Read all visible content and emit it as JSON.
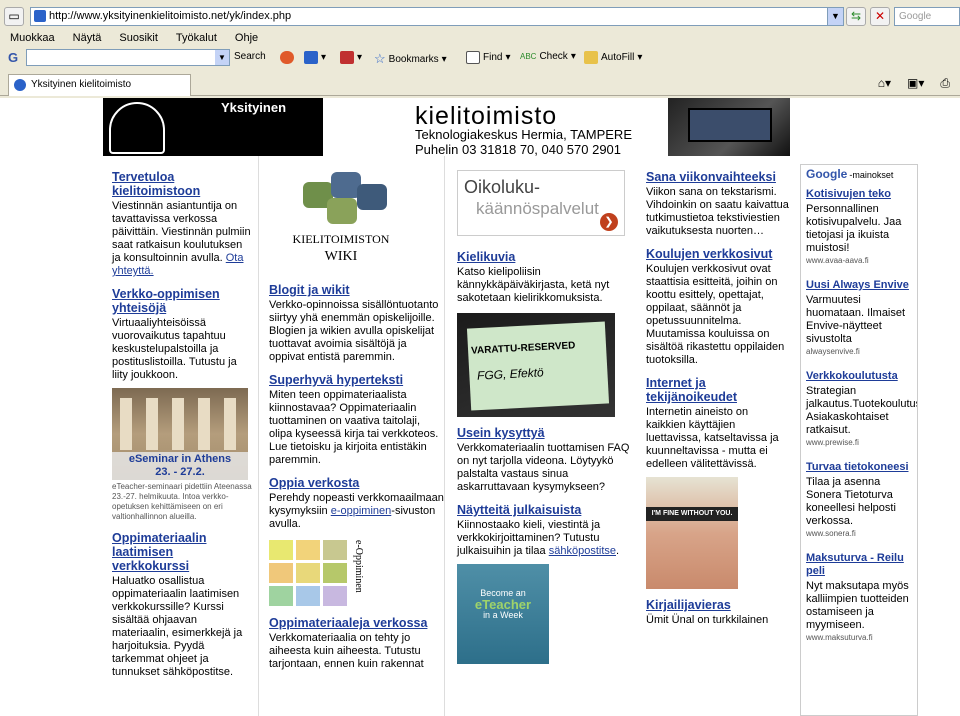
{
  "browser": {
    "url": "http://www.yksityinenkielitoimisto.net/yk/index.php",
    "search_placeholder": "Google",
    "menu": [
      "Muokkaa",
      "Näytä",
      "Suosikit",
      "Työkalut",
      "Ohje"
    ],
    "toolbar": {
      "search_label": "Search",
      "bookmarks_label": "Bookmarks",
      "find_label": "Find",
      "check_label": "Check",
      "autofill_label": "AutoFill"
    },
    "tab_title": "Yksityinen kielitoimisto"
  },
  "banner": {
    "small": "Yksityinen",
    "title": "kielitoimisto",
    "line1": "Teknologiakeskus Hermia, TAMPERE",
    "line2": "Puhelin 03 31818 70, 040 570 2901"
  },
  "col1": {
    "welcome_title": "Tervetuloa kielitoimistoon",
    "welcome_text": "Viestinnän asiantuntija on tavattavissa verkossa päivittäin. Viestinnän pulmiin saat ratkaisun koulutuksen ja konsultoinnin avulla.",
    "welcome_link": "Ota yhteyttä.",
    "community_title": "Verkko-oppimisen yhteisöjä",
    "community_text": "Virtuaaliyhteisöissä vuorovaikutus tapahtuu keskustelupalstoilla ja postituslistoilla. Tutustu ja liity joukkoon.",
    "athens_caption1": "eSeminar in Athens",
    "athens_caption2": "23. - 27.2.",
    "athens_small": "eTeacher-seminaari pidettiin Ateenassa 23.-27. helmikuuta. Intoa verkko-opetuksen kehittämiseen on eri valtionhallinnon alueilla.",
    "course_title": "Oppimateriaalin laatimisen verkkokurssi",
    "course_text": "Haluatko osallistua oppimateriaalin laatimisen verkkokurssille? Kurssi sisältää ohjaavan materiaalin, esimerkkejä ja harjoituksia. Pyydä tarkemmat ohjeet ja tunnukset sähköpostitse."
  },
  "col2": {
    "wiki_line1": "Kielitoimiston",
    "wiki_line2": "WIKI",
    "blogs_title": "Blogit ja wikit",
    "blogs_text": "Verkko-opinnoissa sisällöntuotanto siirtyy yhä enemmän opiskelijoille. Blogien ja wikien avulla opiskelijat tuottavat avoimia sisältöjä ja oppivat entistä paremmin.",
    "hyper_title": "Superhyvä hyperteksti",
    "hyper_text": "Miten teen oppimateriaalista kiinnostavaa? Oppimateriaalin tuottaminen on vaativa taitolaji, olipa kyseessä kirja tai verkkoteos. Lue tietoisku ja kirjoita entistäkin paremmin.",
    "learn_title": "Oppia verkosta",
    "learn_text": "Perehdy nopeasti verkkomaailmaan kysymyksiin",
    "learn_link": "e-oppiminen",
    "learn_text2": "-sivuston avulla.",
    "grid_label": "e-Oppiminen",
    "material_title": "Oppimateriaaleja verkossa",
    "material_text": "Verkkomateriaalia on tehty jo aiheesta kuin aiheesta. Tutustu tarjontaan, ennen kuin rakennat"
  },
  "col3": {
    "oiko_line1": "Oikoluku-",
    "oiko_line2": "käännöspalvelut",
    "pics_title": "Kielikuvia",
    "pics_text": "Katso kielipoliisin kännykkäpäiväkirjasta, ketä nyt sakotetaan kielirikkomuksista.",
    "sign_text": "VARATTU-RESERVED",
    "sign_hand": "FGG, Efektö",
    "faq_title": "Usein kysyttyä",
    "faq_text": "Verkkomateriaalin tuottamisen FAQ on nyt tarjolla videona. Löytyykö palstalta vastaus sinua askarruttavaan kysymykseen?",
    "show_title": "Näytteitä julkaisuista",
    "show_text": "Kiinnostaako kieli, viestintä ja verkkokirjoittaminen? Tutustu julkaisuihin ja tilaa",
    "show_link": "sähköpostitse",
    "book_line1": "Become an",
    "book_line2": "eTeacher",
    "book_line3": "in a Week"
  },
  "col4": {
    "word_title": "Sana viikonvaihteeksi",
    "word_text": "Viikon sana on tekstarismi. Vihdoinkin on saatu kaivattua tutkimustietoa tekstiviestien vaikutuksesta nuorten…",
    "school_title": "Koulujen verkkosivut",
    "school_text": "Koulujen verkkosivut ovat staattisia esitteitä, joihin on koottu esittely, opettajat, oppilaat, säännöt ja opetussuunnitelma. Muutamissa kouluissa on sisältöä rikastettu oppilaiden tuotoksilla.",
    "net_title": "Internet ja tekijänoikeudet",
    "net_text": "Internetin aineisto on kaikkien käyttäjien luettavissa, katseltavissa ja kuunneltavissa - mutta ei edelleen välitettävissä.",
    "face_text": "I'M FINE WITHOUT YOU.",
    "writer_title": "Kirjailijavieras",
    "writer_text": "Ümit Ünal on turkkilainen"
  },
  "ads": {
    "header_brand": "Google",
    "header_label": "-mainokset",
    "items": [
      {
        "title": "Kotisivujen teko",
        "body": "Personnallinen kotisivupalvelu. Jaa tietojasi ja ikuista muistosi!",
        "url": "www.avaa-aava.fi"
      },
      {
        "title": "Uusi Always Envive",
        "body": "Varmuutesi huomataan. Ilmaiset Envive-näytteet sivustolta",
        "url": "alwaysenvive.fi"
      },
      {
        "title": "Verkkokoulutusta",
        "body": "Strategian jalkautus.Tuotekoulutus. Asiakaskohtaiset ratkaisut.",
        "url": "www.prewise.fi"
      },
      {
        "title": "Turvaa tietokoneesi",
        "body": "Tilaa ja asenna Sonera Tietoturva koneellesi helposti verkossa.",
        "url": "www.sonera.fi"
      },
      {
        "title": "Maksuturva - Reilu peli",
        "body": "Nyt maksutapa myös kalliimpien tuotteiden ostamiseen ja myymiseen.",
        "url": "www.maksuturva.fi"
      }
    ]
  }
}
